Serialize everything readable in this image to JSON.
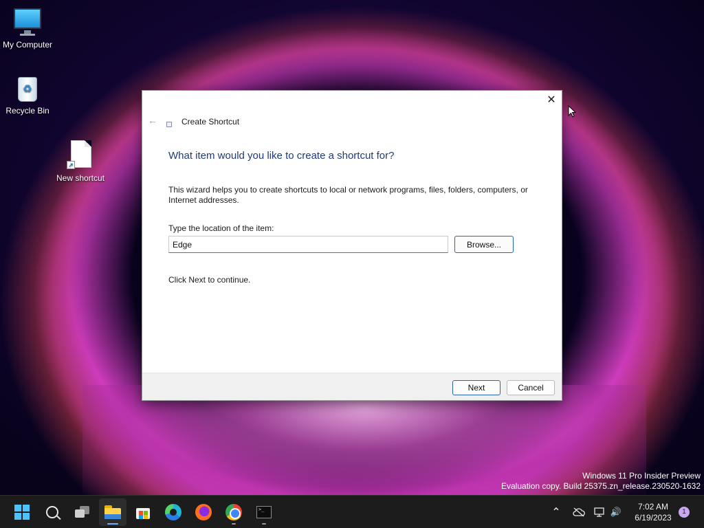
{
  "desktop": {
    "icons": [
      {
        "label": "My Computer"
      },
      {
        "label": "Recycle Bin"
      },
      {
        "label": "New shortcut"
      }
    ]
  },
  "dialog": {
    "close_glyph": "✕",
    "back_glyph": "←",
    "title": "Create Shortcut",
    "heading": "What item would you like to create a shortcut for?",
    "description": "This wizard helps you to create shortcuts to local or network programs, files, folders, computers, or Internet addresses.",
    "location_label": "Type the location of the item:",
    "location_value": "Edge",
    "browse_label": "Browse...",
    "hint": "Click Next to continue.",
    "next_label": "Next",
    "cancel_label": "Cancel"
  },
  "watermark": {
    "line1": "Windows 11 Pro Insider Preview",
    "line2": "Evaluation copy. Build 25375.zn_release.230520-1632"
  },
  "taskbar": {
    "apps": [
      {
        "name": "start-icon"
      },
      {
        "name": "search-icon"
      },
      {
        "name": "task-view-icon"
      },
      {
        "name": "file-explorer-icon",
        "active": true
      },
      {
        "name": "microsoft-store-icon"
      },
      {
        "name": "edge-icon"
      },
      {
        "name": "firefox-icon"
      },
      {
        "name": "chrome-icon",
        "running": true
      },
      {
        "name": "terminal-icon",
        "running": true
      }
    ],
    "tray": {
      "chevron_glyph": "⌃",
      "volume_glyph": "🔊"
    },
    "clock": {
      "time": "7:02 AM",
      "date": "6/19/2023"
    },
    "notification_count": "1"
  },
  "colors": {
    "accent": "#2a62b0",
    "heading": "#1f3a78",
    "taskbar": "#1c1c1c",
    "start": "#4cc2ff"
  }
}
